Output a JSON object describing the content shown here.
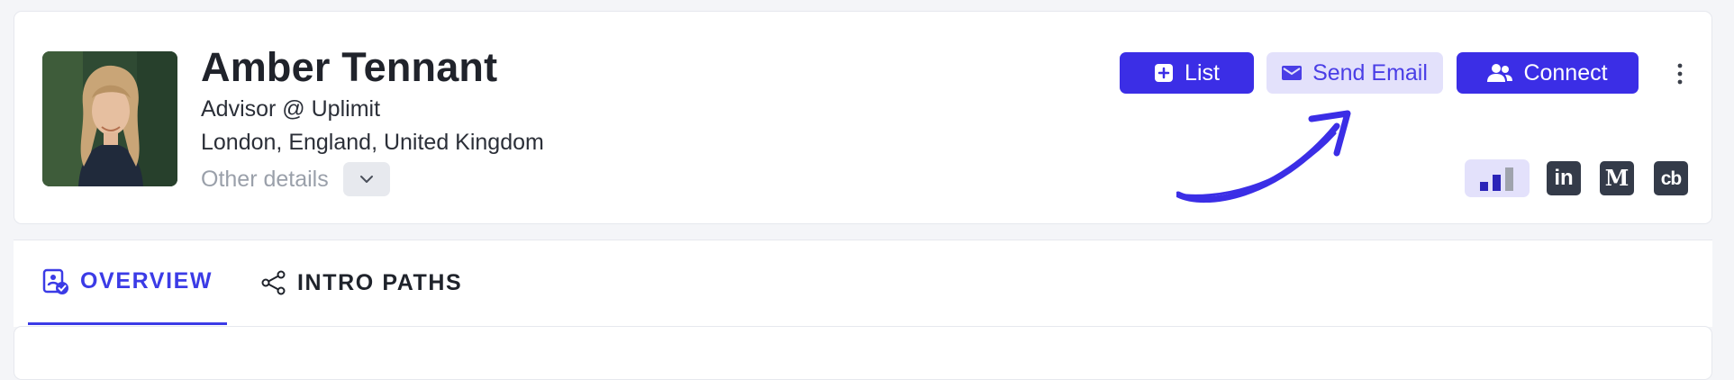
{
  "profile": {
    "name": "Amber Tennant",
    "headline": "Advisor @ Uplimit",
    "location": "London, England, United Kingdom",
    "other_details_label": "Other details",
    "avatar_icon": "person-photo"
  },
  "actions": {
    "list_label": "List",
    "list_icon": "plus-square-icon",
    "send_email_label": "Send Email",
    "send_email_icon": "envelope-icon",
    "connect_label": "Connect",
    "connect_icon": "users-icon",
    "more_icon": "kebab-icon"
  },
  "social": {
    "signal_icon": "signal-strength-icon",
    "linkedin_text": "in",
    "medium_text": "M",
    "crunchbase_text": "cb"
  },
  "tabs": [
    {
      "label": "OVERVIEW",
      "icon": "profile-check-icon",
      "active": true
    },
    {
      "label": "INTRO PATHS",
      "icon": "share-nodes-icon",
      "active": false
    }
  ],
  "colors": {
    "accent": "#3b2ee6",
    "accent_light": "#e3e1fb",
    "text_dark": "#20232b",
    "muted": "#9aa0aa",
    "social_bg": "#343b49"
  }
}
